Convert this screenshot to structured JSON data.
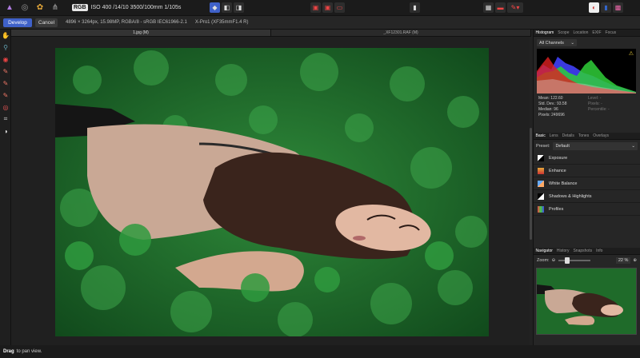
{
  "topbar": {
    "color_mode": "RGB",
    "exif": "ISO 400 /14/10 3500/100mm 1/105s"
  },
  "toolbar2": {
    "develop": "Develop",
    "cancel": "Cancel",
    "image_info": "4896 × 3264px, 15.98MP, RGBA/8 - sRGB IEC61966-2.1",
    "camera": "X-Pro1 (XF35mmF1.4 R)"
  },
  "doc_tabs": [
    "1.jpg (M)",
    "_XF12301.RAF (M)"
  ],
  "panel": {
    "top_tabs": [
      "Histogram",
      "Scope",
      "Location",
      "EXIF",
      "Focus"
    ],
    "channels": "All Channels",
    "stats_left": [
      "Mean: 122.60",
      "Std. Dev.: 93.58",
      "Median: 96",
      "Pixels: 249696"
    ],
    "stats_right": [
      "Level: -",
      "Pixels: -",
      "Percentile: -"
    ],
    "mid_tabs": [
      "Basic",
      "Lens",
      "Details",
      "Tones",
      "Overlays"
    ],
    "preset_label": "Preset:",
    "preset_value": "Default",
    "adjustments": [
      "Exposure",
      "Enhance",
      "White Balance",
      "Shadows & Highlights",
      "Profiles"
    ],
    "bottom_tabs": [
      "Navigator",
      "History",
      "Snapshots",
      "Info"
    ],
    "zoom_label": "Zoom:",
    "zoom_value": "22 %"
  },
  "status": {
    "bold": "Drag",
    "text": "to pan view."
  },
  "colors": {
    "accent": "#3f61c8",
    "grass": "#1f6b2a"
  }
}
